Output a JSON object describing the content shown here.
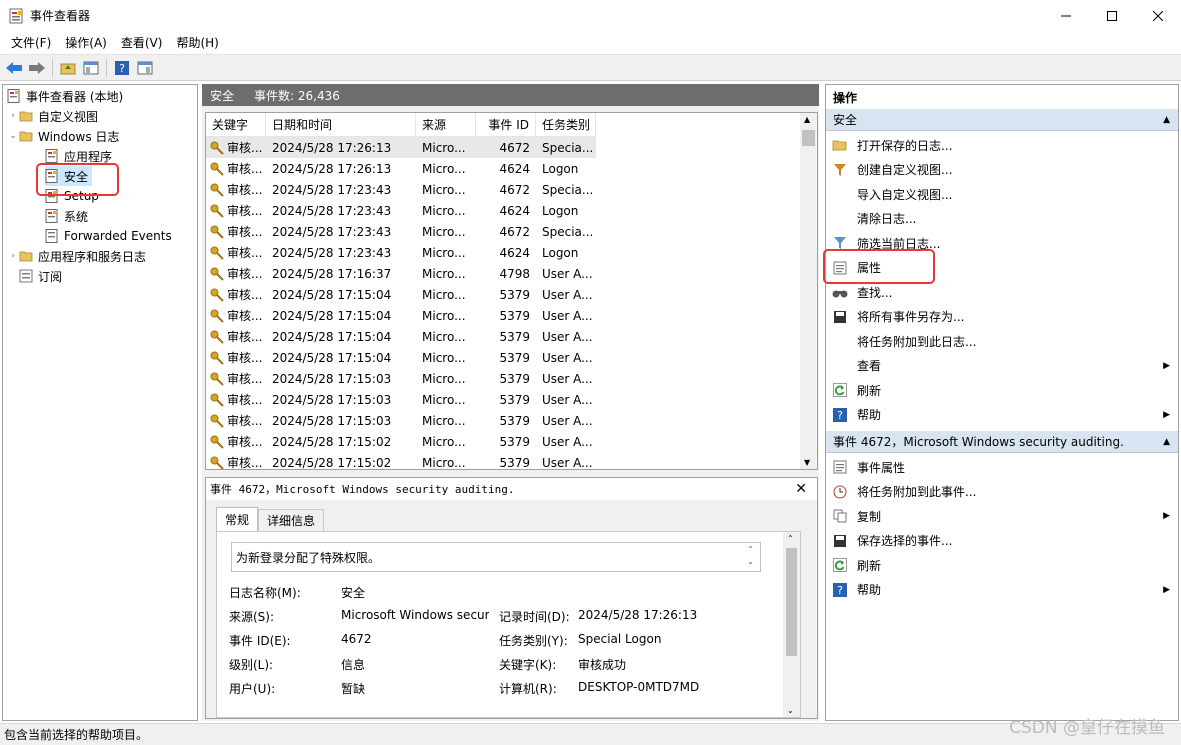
{
  "window": {
    "title": "事件查看器"
  },
  "menu": [
    "文件(F)",
    "操作(A)",
    "查看(V)",
    "帮助(H)"
  ],
  "tree": {
    "root": "事件查看器 (本地)",
    "custom_views": "自定义视图",
    "windows_logs": "Windows 日志",
    "logs": [
      "应用程序",
      "安全",
      "Setup",
      "系统",
      "Forwarded Events"
    ],
    "app_services": "应用程序和服务日志",
    "subscriptions": "订阅"
  },
  "middle": {
    "log_name": "安全",
    "event_count": "事件数: 26,436",
    "columns": [
      "关键字",
      "日期和时间",
      "来源",
      "事件 ID",
      "任务类别"
    ],
    "rows": [
      [
        "审核...",
        "2024/5/28 17:26:13",
        "Micro...",
        "4672",
        "Specia..."
      ],
      [
        "审核...",
        "2024/5/28 17:26:13",
        "Micro...",
        "4624",
        "Logon"
      ],
      [
        "审核...",
        "2024/5/28 17:23:43",
        "Micro...",
        "4672",
        "Specia..."
      ],
      [
        "审核...",
        "2024/5/28 17:23:43",
        "Micro...",
        "4624",
        "Logon"
      ],
      [
        "审核...",
        "2024/5/28 17:23:43",
        "Micro...",
        "4672",
        "Specia..."
      ],
      [
        "审核...",
        "2024/5/28 17:23:43",
        "Micro...",
        "4624",
        "Logon"
      ],
      [
        "审核...",
        "2024/5/28 17:16:37",
        "Micro...",
        "4798",
        "User A..."
      ],
      [
        "审核...",
        "2024/5/28 17:15:04",
        "Micro...",
        "5379",
        "User A..."
      ],
      [
        "审核...",
        "2024/5/28 17:15:04",
        "Micro...",
        "5379",
        "User A..."
      ],
      [
        "审核...",
        "2024/5/28 17:15:04",
        "Micro...",
        "5379",
        "User A..."
      ],
      [
        "审核...",
        "2024/5/28 17:15:04",
        "Micro...",
        "5379",
        "User A..."
      ],
      [
        "审核...",
        "2024/5/28 17:15:03",
        "Micro...",
        "5379",
        "User A..."
      ],
      [
        "审核...",
        "2024/5/28 17:15:03",
        "Micro...",
        "5379",
        "User A..."
      ],
      [
        "审核...",
        "2024/5/28 17:15:03",
        "Micro...",
        "5379",
        "User A..."
      ],
      [
        "审核...",
        "2024/5/28 17:15:02",
        "Micro...",
        "5379",
        "User A..."
      ],
      [
        "审核...",
        "2024/5/28 17:15:02",
        "Micro...",
        "5379",
        "User A..."
      ]
    ]
  },
  "detail": {
    "header": "事件 4672，Microsoft Windows security auditing.",
    "tabs": [
      "常规",
      "详细信息"
    ],
    "message": "为新登录分配了特殊权限。",
    "fields": {
      "log_name_label": "日志名称(M):",
      "log_name_value": "安全",
      "source_label": "来源(S):",
      "source_value": "Microsoft Windows secur",
      "logged_label": "记录时间(D):",
      "logged_value": "2024/5/28 17:26:13",
      "event_id_label": "事件 ID(E):",
      "event_id_value": "4672",
      "task_label": "任务类别(Y):",
      "task_value": "Special Logon",
      "level_label": "级别(L):",
      "level_value": "信息",
      "keywords_label": "关键字(K):",
      "keywords_value": "审核成功",
      "user_label": "用户(U):",
      "user_value": "暂缺",
      "computer_label": "计算机(R):",
      "computer_value": "DESKTOP-0MTD7MD"
    }
  },
  "actions": {
    "header": "操作",
    "section1": "安全",
    "section1_items": [
      "打开保存的日志...",
      "创建自定义视图...",
      "导入自定义视图...",
      "清除日志...",
      "筛选当前日志...",
      "属性",
      "查找...",
      "将所有事件另存为...",
      "将任务附加到此日志...",
      "查看",
      "刷新",
      "帮助"
    ],
    "section2": "事件 4672，Microsoft Windows security auditing.",
    "section2_items": [
      "事件属性",
      "将任务附加到此事件...",
      "复制",
      "保存选择的事件...",
      "刷新",
      "帮助"
    ]
  },
  "status": "包含当前选择的帮助项目。",
  "watermark": "CSDN @皇仔在摸鱼",
  "colors": {
    "accent_red": "#e53935",
    "selection": "#cce8ff",
    "section_header": "#d9e4f2",
    "middle_header": "#6d6d6d"
  }
}
